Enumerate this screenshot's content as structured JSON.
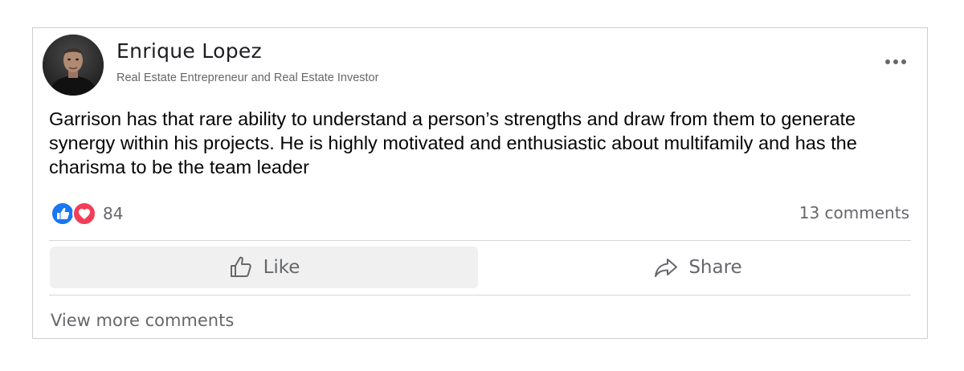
{
  "post": {
    "author": {
      "name": "Enrique Lopez",
      "subtitle": "Real Estate Entrepreneur and Real Estate Investor",
      "avatar_icon": "profile-photo"
    },
    "more_icon": "ellipsis-icon",
    "text": "Garrison has that rare ability to understand a person’s strengths and draw from them to generate synergy within his projects. He is highly motivated and enthusiastic about multifamily and has the charisma to be the team leader",
    "reactions": {
      "icons": [
        "like-reaction-icon",
        "love-reaction-icon"
      ],
      "count": "84"
    },
    "comments_count": "13 comments",
    "actions": {
      "like_label": "Like",
      "share_label": "Share"
    },
    "view_more_label": "View more comments"
  },
  "colors": {
    "like_blue": "#1877f2",
    "love_red": "#f33e58",
    "secondary_text": "#65676b",
    "like_button_bg": "#f0f0f0"
  }
}
